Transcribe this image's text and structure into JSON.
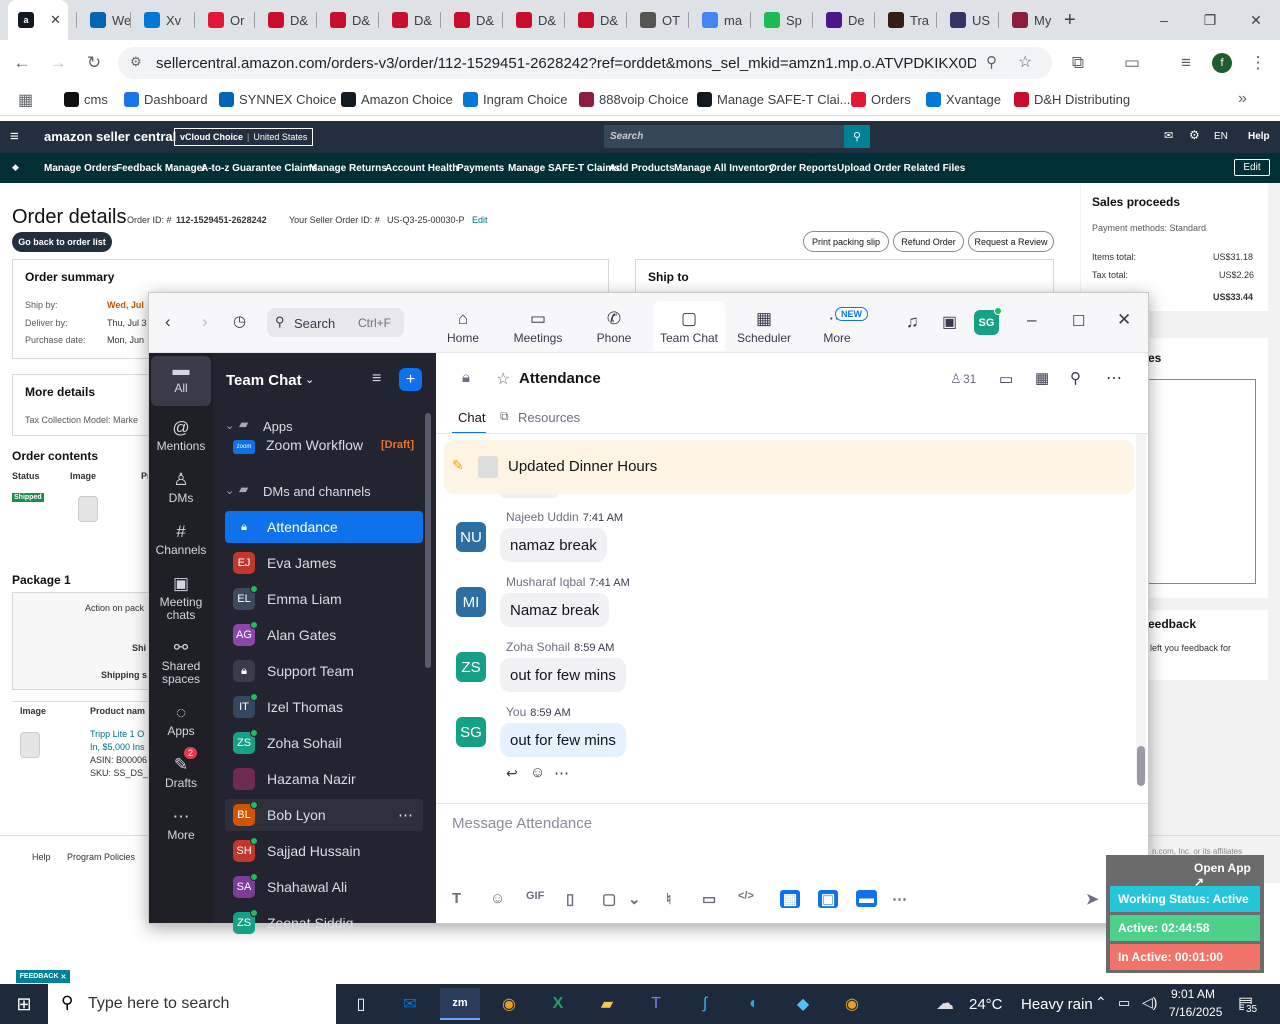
{
  "browser": {
    "tabs": [
      {
        "label": "",
        "icon": "amazon-icon",
        "color": "#131921"
      },
      {
        "label": "We",
        "icon": "synnex-icon",
        "color": "#0066b3"
      },
      {
        "label": "Xv",
        "icon": "xvantage-icon",
        "color": "#0078d4"
      },
      {
        "label": "Or",
        "icon": "orders-icon",
        "color": "#e31837"
      },
      {
        "label": "D&",
        "icon": "dh-icon",
        "color": "#c8102e"
      },
      {
        "label": "D&",
        "icon": "dh-icon",
        "color": "#c8102e"
      },
      {
        "label": "D&",
        "icon": "dh-icon",
        "color": "#c8102e"
      },
      {
        "label": "D&",
        "icon": "dh-icon",
        "color": "#c8102e"
      },
      {
        "label": "D&",
        "icon": "dh-icon",
        "color": "#c8102e"
      },
      {
        "label": "D&",
        "icon": "dh-icon",
        "color": "#c8102e"
      },
      {
        "label": "OT",
        "icon": "ot-icon",
        "color": "#555555"
      },
      {
        "label": "ma",
        "icon": "google-icon",
        "color": "#4285f4"
      },
      {
        "label": "Sp",
        "icon": "spotify-icon",
        "color": "#1db954"
      },
      {
        "label": "De",
        "icon": "fedex-icon",
        "color": "#4d148c"
      },
      {
        "label": "Tra",
        "icon": "ups-icon",
        "color": "#351c15"
      },
      {
        "label": "US",
        "icon": "usps-icon",
        "color": "#333366"
      },
      {
        "label": "My",
        "icon": "my-icon",
        "color": "#8b1e3f"
      }
    ],
    "url": "sellercentral.amazon.com/orders-v3/order/112-1529451-2628242?ref=orddet&mons_sel_mkid=amzn1.mp.o.ATVPDKIKX0DER&mo...",
    "bookmarks": [
      {
        "label": "cms",
        "color": "#111111"
      },
      {
        "label": "Dashboard",
        "color": "#1a73e8"
      },
      {
        "label": "SYNNEX Choice",
        "color": "#0066b3"
      },
      {
        "label": "Amazon Choice",
        "color": "#131921"
      },
      {
        "label": "Ingram Choice",
        "color": "#0078d4"
      },
      {
        "label": "888voip Choice",
        "color": "#8b1e3f"
      },
      {
        "label": "Manage SAFE-T Clai...",
        "color": "#131921"
      },
      {
        "label": "Orders",
        "color": "#e31837"
      },
      {
        "label": "Xvantage",
        "color": "#0078d4"
      },
      {
        "label": "D&H Distributing",
        "color": "#c8102e"
      }
    ]
  },
  "seller": {
    "logo": "amazon seller central",
    "store": "vCloud Choice",
    "country": "United States",
    "search_placeholder": "Search",
    "lang": "EN",
    "help": "Help",
    "nav": [
      "Manage Orders",
      "Feedback Manager",
      "A-to-z Guarantee Claims",
      "Manage Returns",
      "Account Health",
      "Payments",
      "Manage SAFE-T Claims",
      "Add Products",
      "Manage All Inventory",
      "Order Reports",
      "Upload Order Related Files"
    ],
    "edit": "Edit",
    "title": "Order details",
    "order_id_label": "Order ID: #",
    "order_id": "112-1529451-2628242",
    "seller_order_label": "Your Seller Order ID: #",
    "seller_order_id": "US-Q3-25-00030-P",
    "seller_order_edit": "Edit",
    "back": "Go back to order list",
    "btn_print": "Print packing slip",
    "btn_refund": "Refund Order",
    "btn_review": "Request a Review",
    "summary_title": "Order summary",
    "ship_by_label": "Ship by:",
    "ship_by": "Wed, Jul",
    "deliver_by_label": "Deliver by:",
    "deliver_by": "Thu, Jul 3",
    "purchase_label": "Purchase date:",
    "purchase": "Mon, Jun",
    "ship_to": "Ship to",
    "more_details": "More details",
    "tax_model": "Tax Collection Model: Marke",
    "contents": "Order contents",
    "col_status": "Status",
    "col_image": "Image",
    "col_pr": "Pr",
    "shipped": "Shipped",
    "package": "Package 1",
    "action_pack": "Action on pack",
    "shi": "Shi",
    "shipping_s": "Shipping s",
    "col_image2": "Image",
    "col_product": "Product nam",
    "product_line1": "Tripp Lite 1 O",
    "product_line2": "In, $5,000 Ins",
    "asin": "ASIN: B00006",
    "sku": "SKU: SS_DS_S",
    "footer_help": "Help",
    "footer_policies": "Program Policies",
    "feedback_tag": "FEEDBACK",
    "proceeds_title": "Sales proceeds",
    "payment_methods": "Payment methods: Standard",
    "items_total_label": "Items total:",
    "items_total": "US$31.18",
    "tax_total_label": "Tax total:",
    "tax_total": "US$2.26",
    "grand_total": "US$33.44",
    "es": "es",
    "feedback_title": "eedback",
    "feedback_text": "left you feedback for",
    "copyright": "n.com, Inc. or its affiliates"
  },
  "zoom": {
    "search_label": "Search",
    "search_shortcut": "Ctrl+F",
    "tabs": [
      {
        "label": "Home",
        "icon": "home-icon",
        "glyph": "⌂"
      },
      {
        "label": "Meetings",
        "icon": "camera-icon",
        "glyph": "▭"
      },
      {
        "label": "Phone",
        "icon": "phone-icon",
        "glyph": "✆"
      },
      {
        "label": "Team Chat",
        "icon": "chat-icon",
        "glyph": "▢"
      },
      {
        "label": "Scheduler",
        "icon": "calendar-icon",
        "glyph": "▦"
      },
      {
        "label": "More",
        "icon": "more-icon",
        "glyph": "⋯"
      }
    ],
    "new_badge": "NEW",
    "profile_initials": "SG",
    "rail": [
      {
        "label": "All",
        "glyph": "▬",
        "name": "rail-all"
      },
      {
        "label": "Mentions",
        "glyph": "@",
        "name": "rail-mentions"
      },
      {
        "label": "DMs",
        "glyph": "♙",
        "name": "rail-dms"
      },
      {
        "label": "Channels",
        "glyph": "#",
        "name": "rail-channels"
      },
      {
        "label": "Meeting chats",
        "glyph": "▣",
        "name": "rail-meeting-chats"
      },
      {
        "label": "Shared spaces",
        "glyph": "⚯",
        "name": "rail-shared-spaces"
      },
      {
        "label": "Apps",
        "glyph": "◌",
        "name": "rail-apps"
      },
      {
        "label": "Drafts",
        "glyph": "✎",
        "name": "rail-drafts"
      },
      {
        "label": "More",
        "glyph": "⋯",
        "name": "rail-more"
      }
    ],
    "drafts_badge": "2",
    "sidebar_title": "Team Chat",
    "apps_label": "Apps",
    "workflow_label": "Zoom Workflow",
    "workflow_tag": "[Draft]",
    "dms_label": "DMs and channels",
    "contacts": [
      {
        "name": "Attendance",
        "initials": "",
        "color": "#0e72ed",
        "lock": true
      },
      {
        "name": "Eva James",
        "initials": "EJ",
        "color": "#c0392b"
      },
      {
        "name": "Emma Liam",
        "initials": "EL",
        "color": "#3b4a5c"
      },
      {
        "name": "Alan Gates",
        "initials": "AG",
        "color": "#8e44ad"
      },
      {
        "name": "Support Team",
        "initials": "",
        "color": "#3a3a48",
        "lock": true
      },
      {
        "name": "Izel Thomas",
        "initials": "IT",
        "color": "#34495e"
      },
      {
        "name": "Zoha Sohail",
        "initials": "ZS",
        "color": "#16a085"
      },
      {
        "name": "Hazama Nazir",
        "initials": "",
        "color": "#6d2b4e"
      },
      {
        "name": "Bob Lyon",
        "initials": "BL",
        "color": "#d35400"
      },
      {
        "name": "Sajjad Hussain",
        "initials": "SH",
        "color": "#c0392b"
      },
      {
        "name": "Shahawal Ali",
        "initials": "SA",
        "color": "#7d3c98"
      },
      {
        "name": "Zeenat Siddiq",
        "initials": "ZS",
        "color": "#16a085"
      }
    ],
    "channel_title": "Attendance",
    "member_count": "31",
    "tab_chat": "Chat",
    "tab_resources": "Resources",
    "pinned": "Updated Dinner Hours",
    "messages": [
      {
        "sender": "Najeeb Uddin",
        "time": "7:41 AM",
        "text": "namaz break",
        "initials": "NU",
        "color": "#2d6fa3"
      },
      {
        "sender": "Musharaf Iqbal",
        "time": "7:41 AM",
        "text": "Namaz break",
        "initials": "MI",
        "color": "#2d6fa3"
      },
      {
        "sender": "Zoha Sohail",
        "time": "8:59 AM",
        "text": "out for few mins",
        "initials": "ZS",
        "color": "#16a085"
      },
      {
        "sender": "You",
        "time": "8:59 AM",
        "text": "out for few mins",
        "initials": "SG",
        "color": "#16a085"
      }
    ],
    "compose_placeholder": "Message Attendance"
  },
  "widget": {
    "open_app": "Open App ↗",
    "status": "Working Status: Active",
    "active": "Active: 02:44:58",
    "inactive": "In Active: 00:01:00"
  },
  "taskbar": {
    "search_placeholder": "Type here to search",
    "weather_temp": "24°C",
    "weather_desc": "Heavy rain",
    "time": "9:01 AM",
    "date": "7/16/2025",
    "notifications": "35"
  }
}
